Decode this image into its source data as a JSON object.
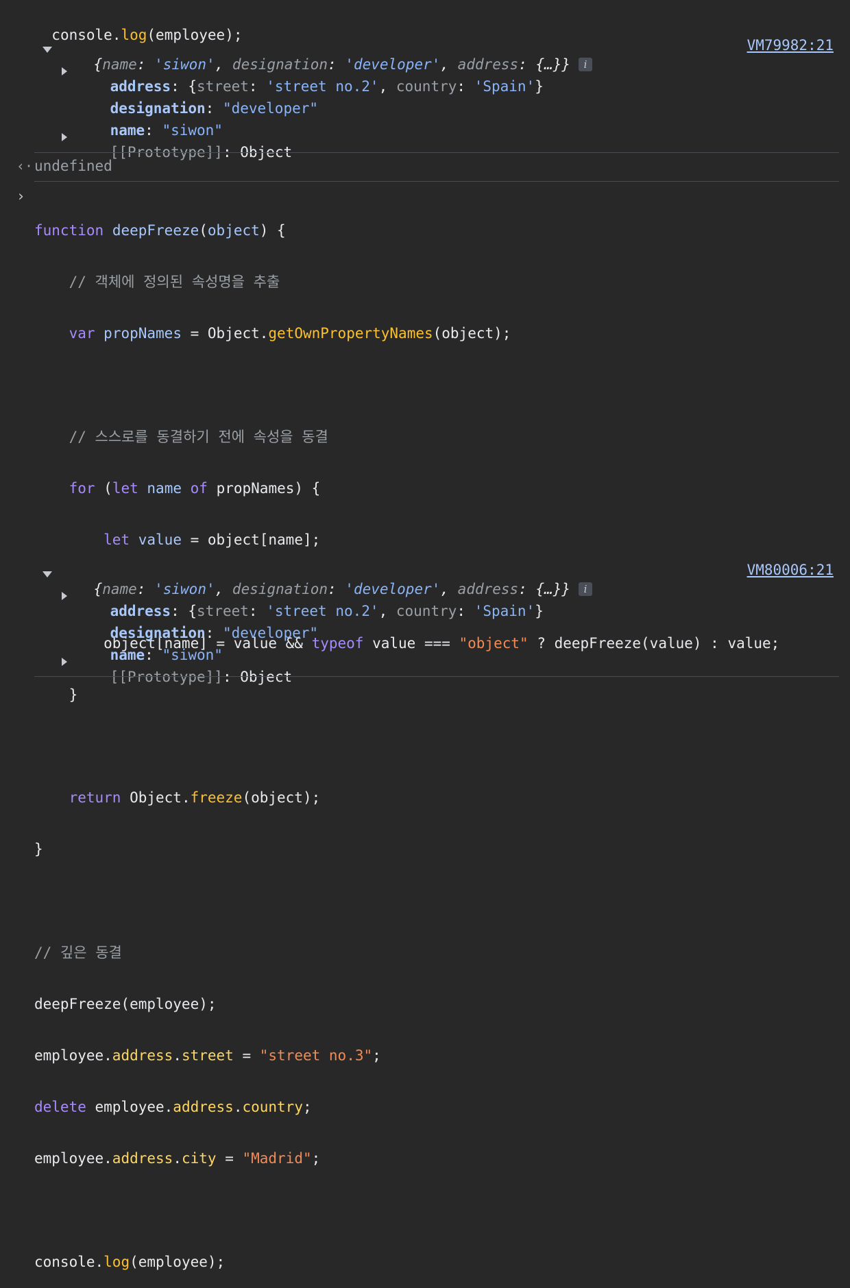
{
  "top_log": {
    "call": [
      "console",
      ".",
      "log",
      "(employee);"
    ],
    "summary": {
      "open": "{",
      "k1": "name",
      "v1": "'siwon'",
      "k2": "designation",
      "v2": "'developer'",
      "k3": "address",
      "v3": "{…}",
      "close": "}"
    },
    "info_label": "i",
    "source": "VM79982:21",
    "props": {
      "address_key": "address",
      "address_val_open": "{",
      "street_key": "street",
      "street_val": "'street no.2'",
      "country_key": "country",
      "country_val": "'Spain'",
      "address_val_close": "}",
      "designation_key": "designation",
      "designation_val": "\"developer\"",
      "name_key": "name",
      "name_val": "\"siwon\"",
      "proto_key": "[[Prototype]]",
      "proto_val": "Object"
    }
  },
  "return_value": "undefined",
  "prompt_out_icon": "‹·",
  "prompt_in_icon": "›",
  "code": {
    "l1": [
      "function",
      " ",
      "deepFreeze",
      "(",
      "object",
      ") {"
    ],
    "l2": "    // 객체에 정의된 속성명을 추출",
    "l3": [
      "    ",
      "var",
      " ",
      "propNames",
      " = Object.",
      "getOwnPropertyNames",
      "(object);"
    ],
    "l5": "    // 스스로를 동결하기 전에 속성을 동결",
    "l6": [
      "    ",
      "for",
      " (",
      "let",
      " ",
      "name",
      " ",
      "of",
      " propNames) {"
    ],
    "l7": [
      "        ",
      "let",
      " ",
      "value",
      " = object[name];"
    ],
    "l9": [
      "        object[name] = value && ",
      "typeof",
      " value === ",
      "\"object\"",
      " ? deepFreeze(value) : value;"
    ],
    "l10": "    }",
    "l12": [
      "    ",
      "return",
      " Object.",
      "freeze",
      "(object);"
    ],
    "l13": "}",
    "l15": "// 깊은 동결",
    "l16": "deepFreeze(employee);",
    "l17": [
      "employee.",
      "address",
      ".",
      "street",
      " = ",
      "\"street no.3\"",
      ";"
    ],
    "l18": [
      "delete",
      " employee.",
      "address",
      ".",
      "country",
      ";"
    ],
    "l19": [
      "employee.",
      "address",
      ".",
      "city",
      " = ",
      "\"Madrid\"",
      ";"
    ],
    "l21": [
      "console.",
      "log",
      "(employee);"
    ]
  },
  "bottom_log": {
    "summary": {
      "open": "{",
      "k1": "name",
      "v1": "'siwon'",
      "k2": "designation",
      "v2": "'developer'",
      "k3": "address",
      "v3": "{…}",
      "close": "}"
    },
    "info_label": "i",
    "source": "VM80006:21",
    "props": {
      "address_key": "address",
      "address_val_open": "{",
      "street_key": "street",
      "street_val": "'street no.2'",
      "country_key": "country",
      "country_val": "'Spain'",
      "address_val_close": "}",
      "designation_key": "designation",
      "designation_val": "\"developer\"",
      "name_key": "name",
      "name_val": "\"siwon\"",
      "proto_key": "[[Prototype]]",
      "proto_val": "Object"
    }
  },
  "colors": {
    "background": "#282828",
    "keyword": "#c792ea",
    "string": "#f28b54",
    "property": "#fdd663",
    "link": "#a8c7fa"
  }
}
